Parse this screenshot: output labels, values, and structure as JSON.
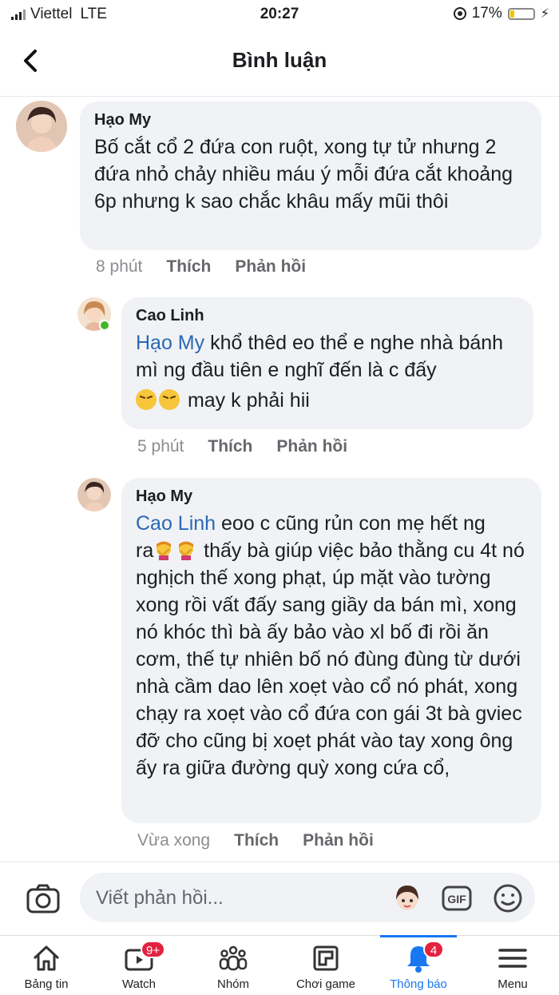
{
  "status_bar": {
    "carrier": "Viettel",
    "network": "LTE",
    "time": "20:27",
    "battery_percent": "17%",
    "battery_level": 0.17
  },
  "header": {
    "title": "Bình luận"
  },
  "comments": [
    {
      "author": "Hạo My",
      "text": "Bố cắt cổ 2 đứa con ruột, xong tự tử nhưng 2 đứa nhỏ chảy nhiều máu ý mỗi đứa cắt khoảng 6p  nhưng k sao chắc khâu mấy mũi thôi",
      "time": "8 phút",
      "like": "Thích",
      "reply": "Phản hồi"
    },
    {
      "author": "Cao Linh",
      "mention": "Hạo My",
      "text": " khổ thêd eo thể e nghe nhà bánh mì ng đầu tiên e nghĩ đến là c đấy",
      "emoji_text": "may k phải hii",
      "emoji": "tired-face",
      "time": "5 phút",
      "like": "Thích",
      "reply": "Phản hồi"
    },
    {
      "author": "Hạo My",
      "mention": "Cao Linh",
      "text_line1": "  eoo c cũng rủn con mẹ hết ng",
      "text_start": "ra",
      "emoji": "facepalm",
      "text": " thấy bà giúp việc bảo thằng cu 4t nó  nghịch thế xong phạt, úp mặt vào tường xong rồi vất đấy sang giầy da bán mì, xong nó khóc  thì bà ấy bảo vào xl bố đi rồi ăn cơm, thế tự nhiên bố nó đùng đùng từ dưới nhà cầm dao lên xoẹt vào cổ nó phát, xong chạy ra xoẹt vào cổ  đứa con gái 3t bà gviec đỡ cho cũng bị xoẹt phát vào tay xong ông ấy ra giữa đường quỳ xong cứa cổ,",
      "time": "Vừa xong",
      "like": "Thích",
      "reply": "Phản hồi"
    }
  ],
  "reply_bar": {
    "placeholder": "Viết phản hồi...",
    "gif_label": "GIF"
  },
  "nav": {
    "tabs": [
      {
        "label": "Bảng tin",
        "icon": "home-icon"
      },
      {
        "label": "Watch",
        "icon": "watch-icon",
        "badge": "9+"
      },
      {
        "label": "Nhóm",
        "icon": "groups-icon"
      },
      {
        "label": "Chơi game",
        "icon": "gaming-icon"
      },
      {
        "label": "Thông báo",
        "icon": "bell-icon",
        "badge": "4"
      },
      {
        "label": "Menu",
        "icon": "menu-icon"
      }
    ]
  },
  "colors": {
    "mention": "#2a69b3",
    "accent": "#1877f2",
    "bubble": "#f0f2f5",
    "badge": "#e4213f"
  }
}
